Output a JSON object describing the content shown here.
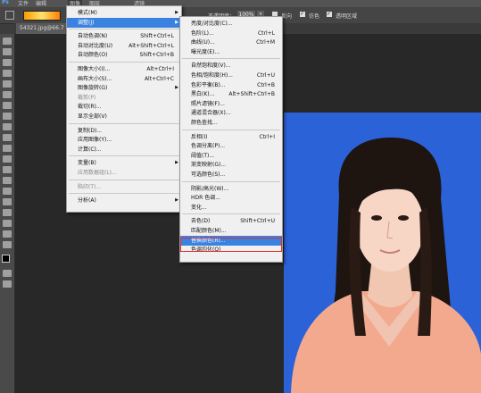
{
  "menubar": {
    "ps": "Ps",
    "file": "文件",
    "edit": "编辑",
    "image": "图像",
    "layer": "图层",
    "filter": "滤镜"
  },
  "options": {
    "opacity_label": "不透明度：",
    "opacity_value": "100%",
    "reverse": "反向",
    "dither": "仿色",
    "transparency": "透明区域"
  },
  "document": {
    "tab": "54321.jpg@66.7"
  },
  "image_menu": [
    {
      "label": "模式(M)",
      "shortcut": "",
      "arrow": true
    },
    {
      "label": "调整(J)",
      "shortcut": "",
      "arrow": true,
      "selected": true
    },
    {
      "sep": true
    },
    {
      "label": "自动色调(N)",
      "shortcut": "Shift+Ctrl+L"
    },
    {
      "label": "自动对比度(U)",
      "shortcut": "Alt+Shift+Ctrl+L"
    },
    {
      "label": "自动颜色(O)",
      "shortcut": "Shift+Ctrl+B"
    },
    {
      "sep": true
    },
    {
      "label": "图像大小(I)...",
      "shortcut": "Alt+Ctrl+I"
    },
    {
      "label": "画布大小(S)...",
      "shortcut": "Alt+Ctrl+C"
    },
    {
      "label": "图像旋转(G)",
      "shortcut": "",
      "arrow": true
    },
    {
      "label": "裁剪(P)",
      "shortcut": "",
      "disabled": true
    },
    {
      "label": "裁切(R)...",
      "shortcut": ""
    },
    {
      "label": "显示全部(V)",
      "shortcut": ""
    },
    {
      "sep": true
    },
    {
      "label": "复制(D)...",
      "shortcut": ""
    },
    {
      "label": "应用图像(Y)...",
      "shortcut": ""
    },
    {
      "label": "计算(C)...",
      "shortcut": ""
    },
    {
      "sep": true
    },
    {
      "label": "变量(B)",
      "shortcut": "",
      "arrow": true
    },
    {
      "label": "应用数据组(L)...",
      "shortcut": "",
      "disabled": true
    },
    {
      "sep": true
    },
    {
      "label": "陷印(T)...",
      "shortcut": "",
      "disabled": true
    },
    {
      "sep": true
    },
    {
      "label": "分析(A)",
      "shortcut": "",
      "arrow": true
    }
  ],
  "adjust_menu": [
    {
      "label": "亮度/对比度(C)...",
      "shortcut": ""
    },
    {
      "label": "色阶(L)...",
      "shortcut": "Ctrl+L"
    },
    {
      "label": "曲线(U)...",
      "shortcut": "Ctrl+M"
    },
    {
      "label": "曝光度(E)...",
      "shortcut": ""
    },
    {
      "sep": true
    },
    {
      "label": "自然饱和度(V)...",
      "shortcut": ""
    },
    {
      "label": "色相/饱和度(H)...",
      "shortcut": "Ctrl+U"
    },
    {
      "label": "色彩平衡(B)...",
      "shortcut": "Ctrl+B"
    },
    {
      "label": "黑白(K)...",
      "shortcut": "Alt+Shift+Ctrl+B"
    },
    {
      "label": "照片滤镜(F)...",
      "shortcut": ""
    },
    {
      "label": "通道混合器(X)...",
      "shortcut": ""
    },
    {
      "label": "颜色查找...",
      "shortcut": ""
    },
    {
      "sep": true
    },
    {
      "label": "反相(I)",
      "shortcut": "Ctrl+I"
    },
    {
      "label": "色调分离(P)...",
      "shortcut": ""
    },
    {
      "label": "阈值(T)...",
      "shortcut": ""
    },
    {
      "label": "渐变映射(G)...",
      "shortcut": ""
    },
    {
      "label": "可选颜色(S)...",
      "shortcut": ""
    },
    {
      "sep": true
    },
    {
      "label": "阴影/高光(W)...",
      "shortcut": ""
    },
    {
      "label": "HDR 色调...",
      "shortcut": ""
    },
    {
      "label": "变化...",
      "shortcut": ""
    },
    {
      "sep": true
    },
    {
      "label": "去色(D)",
      "shortcut": "Shift+Ctrl+U"
    },
    {
      "label": "匹配颜色(M)...",
      "shortcut": ""
    },
    {
      "label": "替换颜色(R)...",
      "shortcut": "",
      "selected": true
    },
    {
      "label": "色调均化(Q)",
      "shortcut": ""
    }
  ],
  "colors": {
    "menubar": "#535353",
    "photo_bg": "#2b62d8",
    "highlight": "#3a82e0",
    "outline": "#ee2b2b"
  }
}
